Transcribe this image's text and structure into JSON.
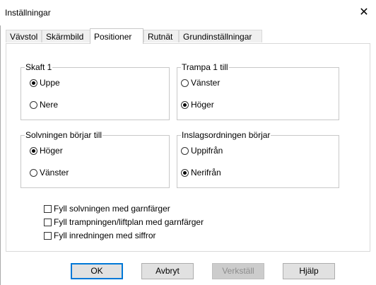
{
  "window": {
    "title": "Inställningar",
    "close_glyph": "✕"
  },
  "tabs": [
    {
      "label": "Vävstol",
      "active": false
    },
    {
      "label": "Skärmbild",
      "active": false
    },
    {
      "label": "Positioner",
      "active": true
    },
    {
      "label": "Rutnät",
      "active": false
    },
    {
      "label": "Grundinställningar",
      "active": false
    }
  ],
  "groups": {
    "skaft": {
      "label": "Skaft 1",
      "options": [
        {
          "label": "Uppe",
          "selected": true
        },
        {
          "label": "Nere",
          "selected": false
        }
      ]
    },
    "trampa": {
      "label": "Trampa 1 till",
      "options": [
        {
          "label": "Vänster",
          "selected": false
        },
        {
          "label": "Höger",
          "selected": true
        }
      ]
    },
    "solvning": {
      "label": "Solvningen börjar till",
      "options": [
        {
          "label": "Höger",
          "selected": true
        },
        {
          "label": "Vänster",
          "selected": false
        }
      ]
    },
    "inslag": {
      "label": "Inslagsordningen börjar",
      "options": [
        {
          "label": "Uppifrån",
          "selected": false
        },
        {
          "label": "Nerifrån",
          "selected": true
        }
      ]
    }
  },
  "checkboxes": [
    {
      "label": "Fyll solvningen med garnfärger",
      "checked": false
    },
    {
      "label": "Fyll trampningen/liftplan med garnfärger",
      "checked": false
    },
    {
      "label": "Fyll inredningen med siffror",
      "checked": false
    }
  ],
  "buttons": {
    "ok": "OK",
    "cancel": "Avbryt",
    "apply": "Verkställ",
    "help": "Hjälp"
  },
  "colors": {
    "default_button_border": "#0078d7",
    "disabled_text": "#8c8c8c"
  }
}
